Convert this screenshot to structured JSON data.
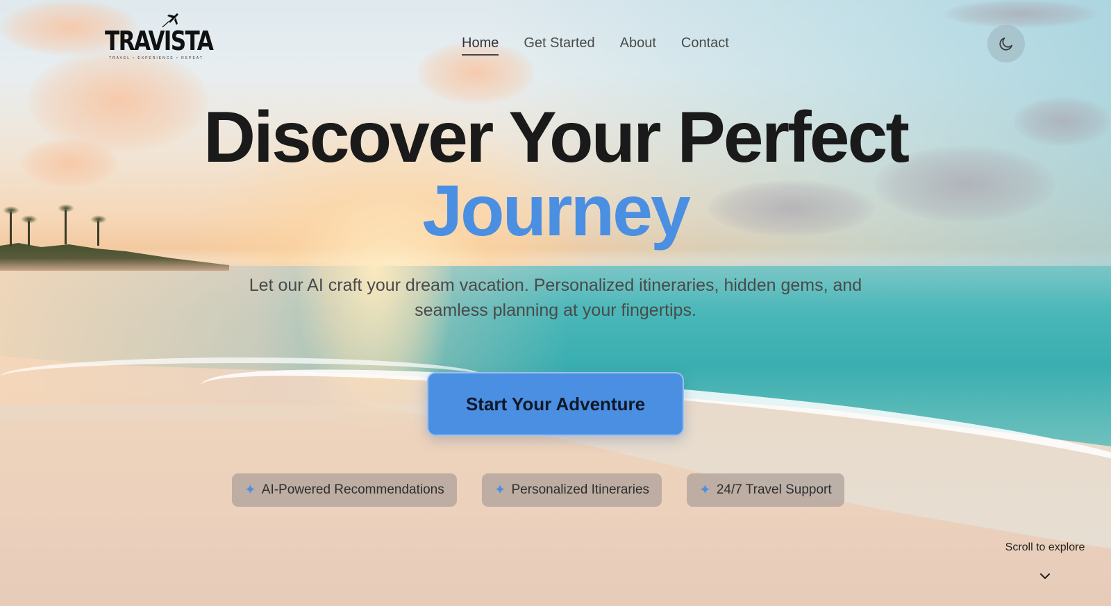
{
  "brand": {
    "logo_text": "TRAVISTA",
    "logo_tagline": "TRAVEL • EXPERIENCE • REPEAT"
  },
  "nav": {
    "items": [
      {
        "label": "Home",
        "active": true
      },
      {
        "label": "Get Started",
        "active": false
      },
      {
        "label": "About",
        "active": false
      },
      {
        "label": "Contact",
        "active": false
      }
    ],
    "theme_toggle_icon": "moon-icon"
  },
  "hero": {
    "title_line1": "Discover Your Perfect",
    "title_line2": "Journey",
    "subtitle": "Let our AI craft your dream vacation. Personalized itineraries, hidden gems, and seamless planning at your fingertips.",
    "cta_label": "Start Your Adventure"
  },
  "features": [
    {
      "icon": "sparkle-icon",
      "label": "AI-Powered Recommendations"
    },
    {
      "icon": "sparkle-icon",
      "label": "Personalized Itineraries"
    },
    {
      "icon": "sparkle-icon",
      "label": "24/7 Travel Support"
    }
  ],
  "scroll_hint": {
    "label": "Scroll to explore",
    "icon": "chevron-down-icon"
  },
  "colors": {
    "accent": "#4a8fe2",
    "text_dark": "#1a1a1a"
  }
}
